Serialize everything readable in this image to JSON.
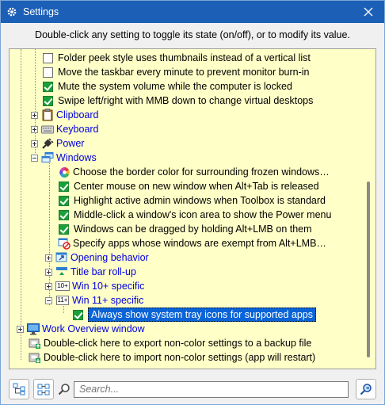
{
  "window": {
    "title": "Settings"
  },
  "instructions": "Double-click any setting to toggle its state (on/off), or to modify its value.",
  "tree": {
    "rows": [
      {
        "text": "Folder peek style uses thumbnails instead of a vertical list",
        "checked": false
      },
      {
        "text": "Move the taskbar every minute to prevent monitor burn-in",
        "checked": false
      },
      {
        "text": "Mute the system volume while the computer is locked",
        "checked": true
      },
      {
        "text": "Swipe left/right with MMB down to change virtual desktops",
        "checked": true
      },
      {
        "text": "Clipboard",
        "icon": "clipboard-icon"
      },
      {
        "text": "Keyboard",
        "icon": "keyboard-icon"
      },
      {
        "text": "Power",
        "icon": "power-plug-icon"
      },
      {
        "text": "Windows",
        "icon": "windows-icon"
      },
      {
        "text": "Choose the border color for surrounding frozen windows…",
        "icon": "color-wheel-icon"
      },
      {
        "text": "Center mouse on new window when Alt+Tab is released",
        "checked": true
      },
      {
        "text": "Highlight active admin windows when Toolbox is standard",
        "checked": true
      },
      {
        "text": "Middle-click a window's icon area to show the Power menu",
        "checked": true
      },
      {
        "text": "Windows can be dragged by holding Alt+LMB on them",
        "checked": true
      },
      {
        "text": "Specify apps whose windows are exempt from Alt+LMB…",
        "icon": "exempt-apps-icon"
      },
      {
        "text": "Opening behavior",
        "icon": "opening-behavior-icon"
      },
      {
        "text": "Title bar roll-up",
        "icon": "title-bar-rollup-icon"
      },
      {
        "text": "Win 10+ specific",
        "icon": "win10-icon",
        "icon_text": "10+"
      },
      {
        "text": "Win 11+ specific",
        "icon": "win11-icon",
        "icon_text": "11+"
      },
      {
        "text": "Always show system tray icons for supported apps",
        "checked": true
      },
      {
        "text": "Work Overview window",
        "icon": "monitor-icon"
      },
      {
        "text": "Double-click here to export non-color settings to a backup file",
        "icon": "export-icon"
      },
      {
        "text": "Double-click here to import non-color settings (app will restart)",
        "icon": "import-icon"
      }
    ]
  },
  "search": {
    "placeholder": "Search..."
  },
  "colors": {
    "titlebar": "#1c5fb6",
    "tree_background": "#ffffc8",
    "category_text": "#0000e0",
    "selection": "#0a64d8",
    "checkbox_on": "#1a9f3a"
  }
}
